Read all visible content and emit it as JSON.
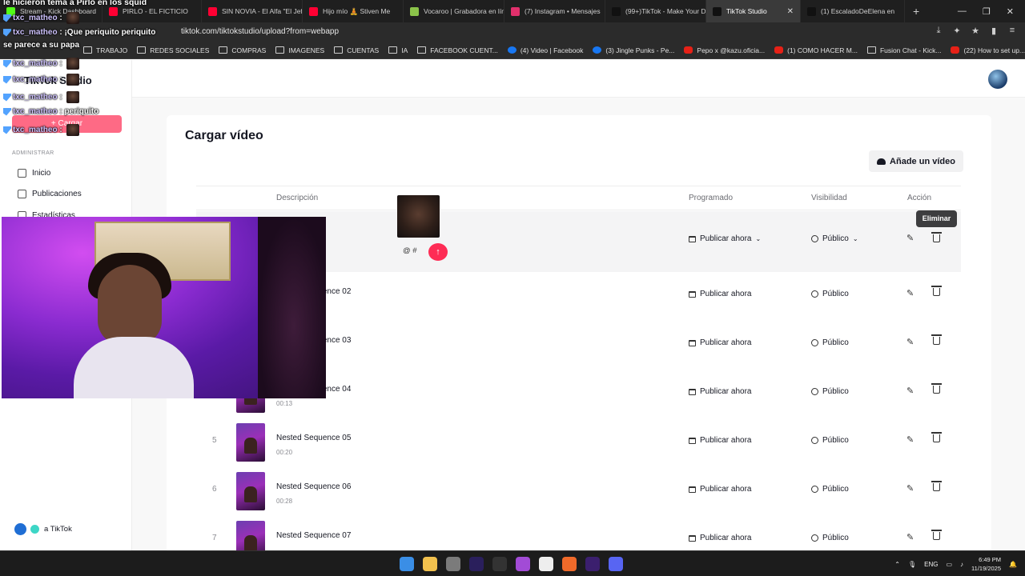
{
  "browser": {
    "tabs": [
      {
        "label": "Stream - Kick Dashboard",
        "color": "#53fc18"
      },
      {
        "label": "PIRLO - EL FICTICIO",
        "color": "#ff0033"
      },
      {
        "label": "SIN NOVIA - El Alfa \"El Jefe\"",
        "color": "#ff0033"
      },
      {
        "label": "Hijo mío 🧘 Stiven Me",
        "color": "#ff0033"
      },
      {
        "label": "Vocaroo | Grabadora en lín",
        "color": "#8bc34a"
      },
      {
        "label": "(7) Instagram • Mensajes",
        "color": "#e1306c"
      },
      {
        "label": "(99+)TikTok - Make Your D",
        "color": "#111111"
      },
      {
        "label": "TikTok Studio",
        "color": "#111111",
        "active": true
      },
      {
        "label": "(1) EscaladoDeElena en",
        "color": "#111111"
      }
    ],
    "url": "tiktok.com/tiktokstudio/upload?from=webapp",
    "bookmarks": [
      {
        "label": "TRABAJO",
        "kind": "folder"
      },
      {
        "label": "REDES SOCIALES",
        "kind": "folder"
      },
      {
        "label": "COMPRAS",
        "kind": "folder"
      },
      {
        "label": "IMAGENES",
        "kind": "folder"
      },
      {
        "label": "CUENTAS",
        "kind": "folder"
      },
      {
        "label": "IA",
        "kind": "folder"
      },
      {
        "label": "FACEBOOK CUENT...",
        "kind": "folder"
      },
      {
        "label": "(4) Video | Facebook",
        "kind": "fb"
      },
      {
        "label": "(3) Jingle Punks - Pe...",
        "kind": "fb"
      },
      {
        "label": "Pepo x @kazu.oficia...",
        "kind": "yt"
      },
      {
        "label": "(1) COMO HACER M...",
        "kind": "yt"
      },
      {
        "label": "Fusion Chat - Kick...",
        "kind": "folder"
      },
      {
        "label": "(22) How to set up...",
        "kind": "yt"
      }
    ]
  },
  "sidebar": {
    "logo": "TikTok Studio",
    "upload_label": "+ Cargar",
    "section_label": "ADMINISTRAR",
    "items": [
      {
        "label": "Inicio"
      },
      {
        "label": "Publicaciones"
      },
      {
        "label": "Estadísticas"
      }
    ],
    "footer_label": "a TikTok"
  },
  "main": {
    "title": "Cargar vídeo",
    "add_video_label": "Añade un vídeo",
    "columns": {
      "description": "Descripción",
      "scheduled": "Programado",
      "visibility": "Visibilidad",
      "action": "Acción"
    },
    "editing_row": {
      "input_value": "@ #",
      "schedule": "Publicar ahora",
      "visibility": "Público"
    },
    "rows": [
      {
        "num": "",
        "name": "Nested Sequence 02",
        "duration": "",
        "schedule": "Publicar ahora",
        "visibility": "Público"
      },
      {
        "num": "",
        "name": "Nested Sequence 03",
        "duration": "",
        "schedule": "Publicar ahora",
        "visibility": "Público"
      },
      {
        "num": "",
        "name": "Nested Sequence 04",
        "duration": "00:13",
        "schedule": "Publicar ahora",
        "visibility": "Público"
      },
      {
        "num": "5",
        "name": "Nested Sequence 05",
        "duration": "00:20",
        "schedule": "Publicar ahora",
        "visibility": "Público"
      },
      {
        "num": "6",
        "name": "Nested Sequence 06",
        "duration": "00:28",
        "schedule": "Publicar ahora",
        "visibility": "Público"
      },
      {
        "num": "7",
        "name": "Nested Sequence 07",
        "duration": "",
        "schedule": "Publicar ahora",
        "visibility": "Público"
      }
    ],
    "tooltip": "Eliminar"
  },
  "stream": {
    "title": "le hicieron tema a Pirlo en los squid",
    "chat": [
      {
        "user": "txc_matheo",
        "text": "",
        "emote": true
      },
      {
        "user": "txc_matheo",
        "text": "¡Que periquito periquito",
        "emote": false
      },
      {
        "user": "",
        "text": "se parece a su papa",
        "emote": false
      },
      {
        "user": "txc_matheo",
        "text": "",
        "emote": true
      },
      {
        "user": "txc_matheo",
        "text": "",
        "emote": true
      },
      {
        "user": "txc_matheo",
        "text": "",
        "emote": true
      },
      {
        "user": "txc_matheo",
        "text": "periquito",
        "emote": false
      },
      {
        "user": "txc_matheo",
        "text": "",
        "emote": true
      }
    ]
  },
  "taskbar": {
    "apps": [
      "windows-start",
      "file-explorer",
      "chrome",
      "premiere",
      "epic-games",
      "figma",
      "capcut",
      "brave",
      "media-encoder",
      "discord"
    ],
    "language": "ENG",
    "time": "6:49 PM",
    "date": "11/19/2025"
  }
}
